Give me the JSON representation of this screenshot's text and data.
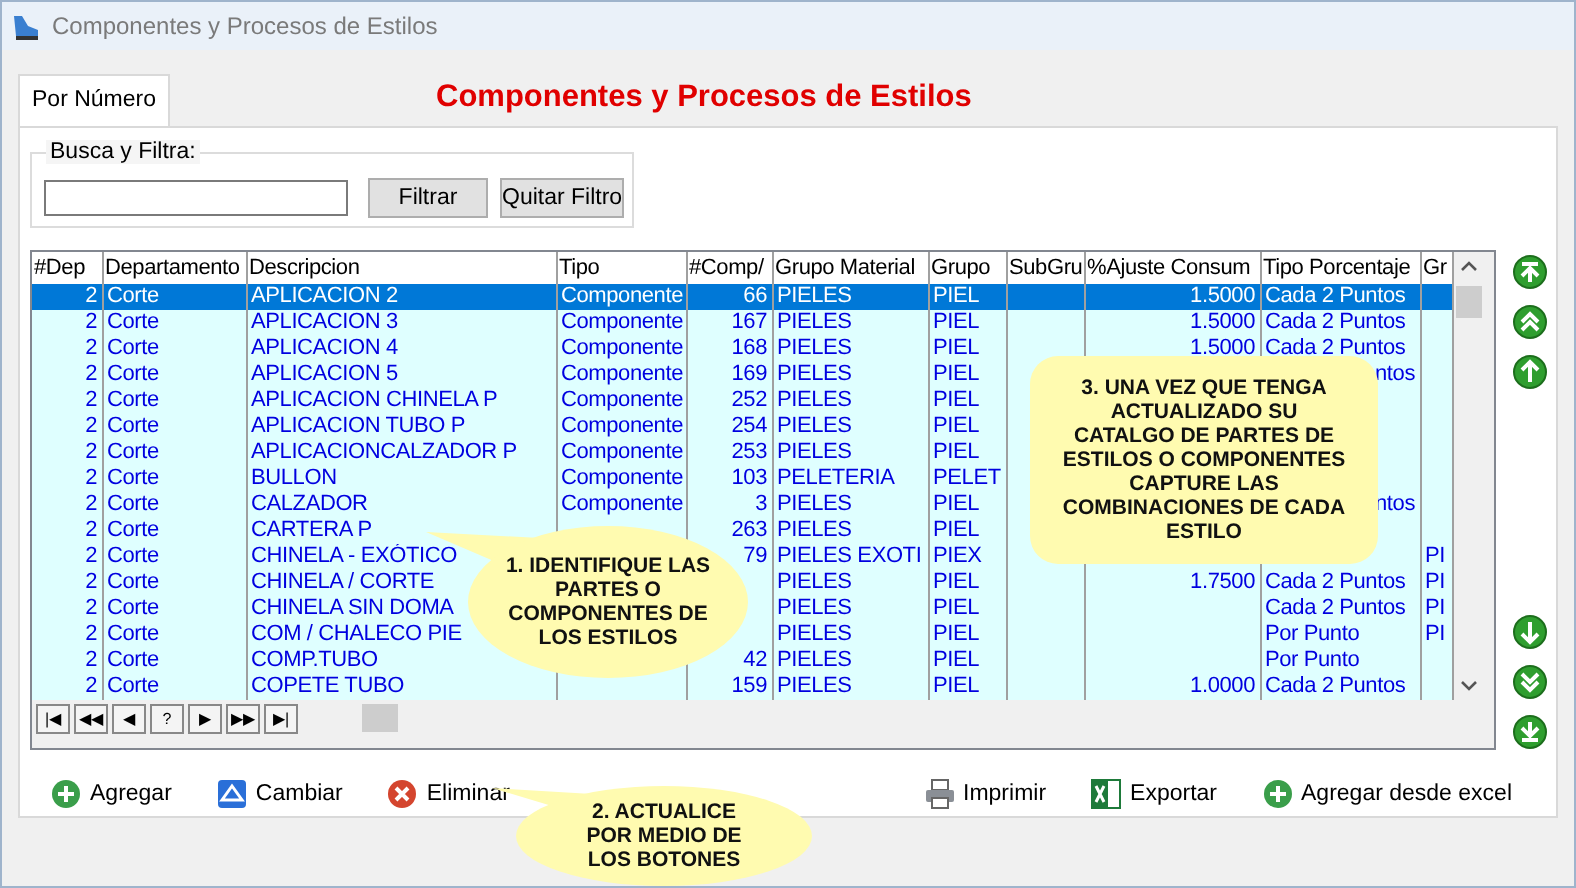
{
  "window": {
    "title": "Componentes y Procesos de Estilos"
  },
  "tabs": [
    {
      "label": "Por Número",
      "selected": true
    }
  ],
  "heading": "Componentes y Procesos de Estilos",
  "filter": {
    "legend": "Busca y Filtra:",
    "buttons": [
      "Filtrar",
      "Quitar Filtro"
    ]
  },
  "table": {
    "columns": [
      "#Dep",
      "Departamento",
      "Descripcion",
      "Tipo",
      "#Comp/",
      "Grupo Material",
      "Grupo",
      "SubGru",
      "%Ajuste Consum",
      "Tipo Porcentaje",
      "Gr"
    ],
    "rows": [
      {
        "selected": true,
        "cells": [
          "2",
          "Corte",
          "APLICACION 2",
          "Componente",
          "66",
          "PIELES",
          "PIEL",
          null,
          "1.5000",
          "Cada 2 Puntos",
          null
        ]
      },
      {
        "selected": false,
        "cells": [
          "2",
          "Corte",
          "APLICACION 3",
          "Componente",
          "167",
          "PIELES",
          "PIEL",
          null,
          "1.5000",
          "Cada 2 Puntos",
          null
        ]
      },
      {
        "selected": false,
        "cells": [
          "2",
          "Corte",
          "APLICACION 4",
          "Componente",
          "168",
          "PIELES",
          "PIEL",
          null,
          "1.5000",
          "Cada 2 Puntos",
          null
        ]
      },
      {
        "selected": false,
        "cells": [
          "2",
          "Corte",
          "APLICACION 5",
          "Componente",
          "169",
          "PIELES",
          "PIEL",
          null,
          null,
          {
            "text": "ntos",
            "cut": true
          },
          null
        ]
      },
      {
        "selected": false,
        "cells": [
          "2",
          "Corte",
          "APLICACION CHINELA P",
          "Componente",
          "252",
          "PIELES",
          "PIEL",
          null,
          null,
          null,
          null
        ]
      },
      {
        "selected": false,
        "cells": [
          "2",
          "Corte",
          "APLICACION TUBO P",
          "Componente",
          "254",
          "PIELES",
          "PIEL",
          null,
          null,
          null,
          null
        ]
      },
      {
        "selected": false,
        "cells": [
          "2",
          "Corte",
          "APLICACIONCALZADOR P",
          "Componente",
          "253",
          "PIELES",
          "PIEL",
          null,
          null,
          null,
          null
        ]
      },
      {
        "selected": false,
        "cells": [
          "2",
          "Corte",
          "BULLON",
          "Componente",
          "103",
          "PELETERIA",
          "PELET",
          null,
          null,
          null,
          null
        ]
      },
      {
        "selected": false,
        "cells": [
          "2",
          "Corte",
          "CALZADOR",
          "Componente",
          "3",
          "PIELES",
          "PIEL",
          null,
          null,
          {
            "text": "ntos",
            "cut": true
          },
          null
        ]
      },
      {
        "selected": false,
        "cells": [
          "2",
          "Corte",
          "CARTERA P",
          null,
          "263",
          "PIELES",
          "PIEL",
          null,
          null,
          null,
          null
        ]
      },
      {
        "selected": false,
        "cells": [
          "2",
          "Corte",
          "CHINELA - EXÓTICO",
          null,
          "79",
          "PIELES EXOTI",
          "PIEX",
          null,
          null,
          null,
          "PI"
        ]
      },
      {
        "selected": false,
        "cells": [
          "2",
          "Corte",
          "CHINELA / CORTE",
          null,
          null,
          "PIELES",
          "PIEL",
          null,
          "1.7500",
          "Cada 2 Puntos",
          "PI"
        ]
      },
      {
        "selected": false,
        "cells": [
          "2",
          "Corte",
          "CHINELA SIN DOMA",
          null,
          null,
          "PIELES",
          "PIEL",
          null,
          null,
          "Cada 2 Puntos",
          "PI"
        ]
      },
      {
        "selected": false,
        "cells": [
          "2",
          "Corte",
          "COM / CHALECO PIE",
          null,
          null,
          "PIELES",
          "PIEL",
          null,
          null,
          "Por Punto",
          "PI"
        ]
      },
      {
        "selected": false,
        "cells": [
          "2",
          "Corte",
          "COMP.TUBO",
          null,
          "42",
          "PIELES",
          "PIEL",
          null,
          null,
          "Por Punto",
          null
        ]
      },
      {
        "selected": false,
        "cells": [
          "2",
          "Corte",
          "COPETE TUBO",
          null,
          "159",
          "PIELES",
          "PIEL",
          null,
          "1.0000",
          "Cada 2 Puntos",
          null
        ]
      }
    ]
  },
  "navigator": [
    "|◀",
    "◀◀",
    "◀",
    "?",
    "▶",
    "▶▶",
    "▶|"
  ],
  "side_buttons": [
    {
      "kind": "first"
    },
    {
      "kind": "page_up"
    },
    {
      "kind": "up"
    },
    {
      "kind": "down"
    },
    {
      "kind": "page_down"
    },
    {
      "kind": "last"
    }
  ],
  "actions": [
    {
      "kind": "add",
      "label": "Agregar"
    },
    {
      "kind": "edit",
      "label": "Cambiar"
    },
    {
      "kind": "delete",
      "label": "Eliminar"
    },
    {
      "kind": "print",
      "label": "Imprimir"
    },
    {
      "kind": "excel",
      "label": "Exportar"
    },
    {
      "kind": "add",
      "label": "Agregar desde excel"
    }
  ],
  "callouts": [
    {
      "kind": "grid",
      "text": "1. IDENTIFIQUE LAS PARTES O COMPONENTES DE LOS ESTILOS"
    },
    {
      "kind": "buttons",
      "text": "2. ACTUALICE POR MEDIO DE LOS BOTONES"
    },
    {
      "kind": "catalog",
      "text": "3. UNA VEZ QUE TENGA ACTUALIZADO SU CATALGO DE PARTES DE ESTILOS O COMPONENTES CAPTURE LAS COMBINACIONES DE CADA ESTILO"
    }
  ]
}
